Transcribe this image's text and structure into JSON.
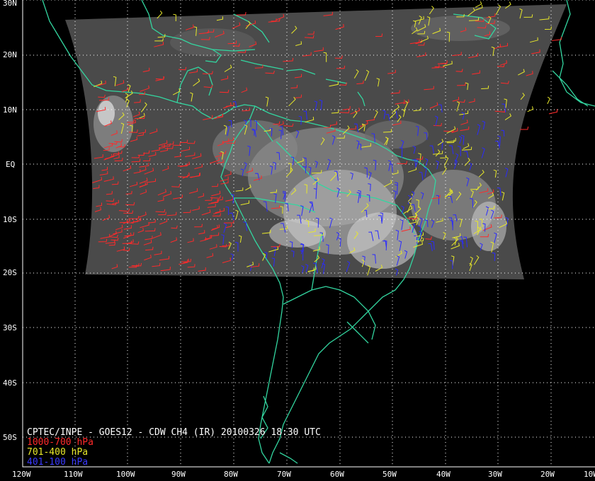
{
  "map": {
    "caption": "CPTEC/INPE - GOES12 - CDW CH4 (IR) 20100326 18:30 UTC",
    "legend": [
      {
        "label": "1000-700 hPa",
        "color": "#ff2a2a"
      },
      {
        "label": "701-400 hPa",
        "color": "#e8e82a"
      },
      {
        "label": "401-100 hPa",
        "color": "#2a2aff"
      }
    ],
    "lat_labels": [
      "30N",
      "20N",
      "10N",
      "EQ",
      "10S",
      "20S",
      "30S",
      "40S",
      "50S"
    ],
    "lon_labels": [
      "120W",
      "110W",
      "100W",
      "90W",
      "80W",
      "70W",
      "60W",
      "50W",
      "40W",
      "30W",
      "20W",
      "10W"
    ],
    "colors": {
      "background": "#000000",
      "imagery": "#4a4a4a",
      "coastline": "#33d6a0",
      "grid": "#ffffff",
      "cloud": "#d8d8d8"
    }
  }
}
